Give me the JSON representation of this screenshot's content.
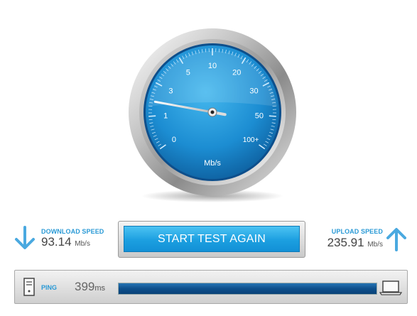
{
  "gauge": {
    "unit": "Mb/s",
    "ticks": [
      "0",
      "1",
      "3",
      "5",
      "10",
      "20",
      "30",
      "50",
      "100+"
    ],
    "needle_tick_index": 1.45
  },
  "download": {
    "label": "DOWNLOAD SPEED",
    "value": "93.14",
    "unit": "Mb/s",
    "icon": "arrow-down-icon"
  },
  "upload": {
    "label": "UPLOAD SPEED",
    "value": "235.91",
    "unit": "Mb/s",
    "icon": "arrow-up-icon"
  },
  "start_button": {
    "label": "START TEST AGAIN"
  },
  "ping": {
    "label": "PING",
    "value": "399",
    "unit": "ms",
    "progress": 1.0
  },
  "colors": {
    "accent": "#1c9fe0",
    "label_blue": "#2a9ad6",
    "progress": "#0d4f8c"
  }
}
